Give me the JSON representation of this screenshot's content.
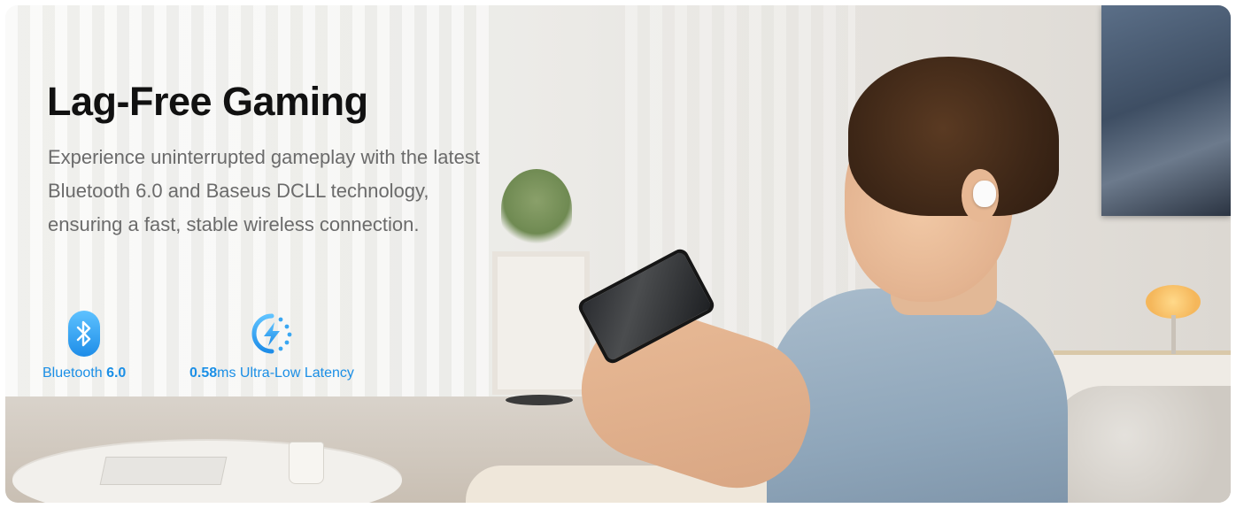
{
  "banner": {
    "headline": "Lag-Free Gaming",
    "description_lines": [
      "Experience uninterrupted gameplay with the latest",
      "Bluetooth 6.0 and Baseus DCLL technology,",
      "ensuring a fast, stable wireless connection."
    ]
  },
  "features": [
    {
      "icon": "bluetooth-icon",
      "label_prefix": "Bluetooth ",
      "label_value": "6.0",
      "label_suffix": ""
    },
    {
      "icon": "lightning-latency-icon",
      "label_prefix": "",
      "label_value": "0.58",
      "label_suffix": "ms Ultra-Low Latency"
    }
  ],
  "colors": {
    "headline": "#111111",
    "description": "#6b6b6b",
    "accent_blue": "#1b8fe6",
    "icon_gradient_top": "#5ec2ff",
    "icon_gradient_bottom": "#1e8de8"
  }
}
